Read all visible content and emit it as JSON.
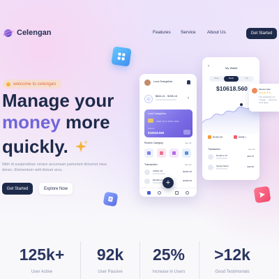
{
  "brand": {
    "name": "Celengan"
  },
  "nav": {
    "items": [
      {
        "label": "Features"
      },
      {
        "label": "Service"
      },
      {
        "label": "About Us"
      }
    ],
    "cta_label": "Get Started"
  },
  "hero": {
    "badge_label": "welcome to celengan",
    "line1": "Manage your",
    "line2_accent": "money",
    "line2_rest": " more",
    "line3": "quickly.",
    "description": "Nibh id suspendisse ornare accumsan parturient dictumst risus donec. Elementum velit dictum arcu.",
    "primary_label": "Get Started",
    "secondary_label": "Explore Now"
  },
  "phone_home": {
    "user_name": "Luca Changeleta",
    "exchange_text": "$644.41 - $198.18",
    "card_name": "Luca Changeleta",
    "card_number": "4096 3274 8563 3892",
    "card_balance_label": "Balance",
    "card_balance": "$10618.560",
    "recent_category_label": "Recent Category",
    "see_all_label": "See All",
    "transaction_label": "Transaction",
    "transactions": [
      {
        "name": "Adidas Ltd",
        "amount": "-$2201.00"
      },
      {
        "name": "Ekolabin Ltd",
        "amount": "-$1820.00"
      }
    ]
  },
  "phone_wallet": {
    "title": "My Wallet",
    "tabs": [
      {
        "label": "Week"
      },
      {
        "label": "Month"
      },
      {
        "label": "Year"
      }
    ],
    "balance": "$10618.560",
    "legend": [
      {
        "label": "$6168.426"
      },
      {
        "label": "$6688.1"
      }
    ],
    "transaction_label": "Transaction",
    "see_all_label": "See All",
    "transactions": [
      {
        "name": "Dropbox Inc",
        "amount": "-$24.76"
      },
      {
        "name": "Spotify Music",
        "amount": "-$16.60"
      }
    ]
  },
  "review": {
    "name": "Marsha Saki",
    "stars": "★★★★★",
    "text": "This Application for manage ... awesome need apply"
  },
  "stats": [
    {
      "value": "125k+",
      "label": "User Active"
    },
    {
      "value": "92k",
      "label": "User Passive"
    },
    {
      "value": "25%",
      "label": "Increase in Users"
    },
    {
      "value": ">12k",
      "label": "Good Testimonials"
    }
  ],
  "colors": {
    "navy": "#1e2a4a",
    "accent": "#6f66d9",
    "badge_bg": "#f6ddcf",
    "badge_text": "#e2703a",
    "tile_blue": "#4fa9f7",
    "tile_pink": "#f45b7d"
  },
  "icons": {
    "logo": "planet-icon",
    "badge": "lightbulb-icon",
    "sparkle": "sparkle-icon",
    "tile_top": "grid-icon",
    "tile_bottom": "document-icon",
    "tile_right": "send-icon",
    "fab": "plus-icon"
  }
}
